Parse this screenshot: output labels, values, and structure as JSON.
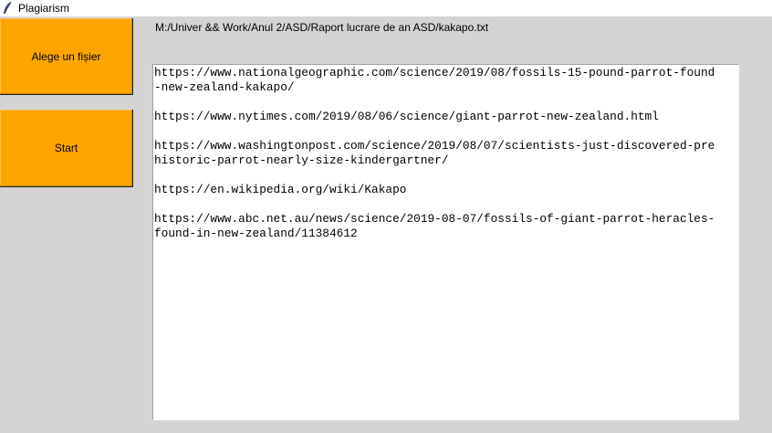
{
  "window": {
    "title": "Plagiarism",
    "icon": "feather-icon"
  },
  "buttons": {
    "choose_label": "Alege un fișier",
    "start_label": "Start"
  },
  "file_path": "M:/Univer && Work/Anul 2/ASD/Raport lucrare de an ASD/kakapo.txt",
  "text_lines": [
    "https://www.nationalgeographic.com/science/2019/08/fossils-15-pound-parrot-found",
    "-new-zealand-kakapo/",
    "",
    "https://www.nytimes.com/2019/08/06/science/giant-parrot-new-zealand.html",
    "",
    "https://www.washingtonpost.com/science/2019/08/07/scientists-just-discovered-pre",
    "historic-parrot-nearly-size-kindergartner/",
    "",
    "https://en.wikipedia.org/wiki/Kakapo",
    "",
    "https://www.abc.net.au/news/science/2019-08-07/fossils-of-giant-parrot-heracles-",
    "found-in-new-zealand/11384612"
  ],
  "colors": {
    "button_bg": "#ffa500",
    "window_bg": "#d4d4d4"
  }
}
